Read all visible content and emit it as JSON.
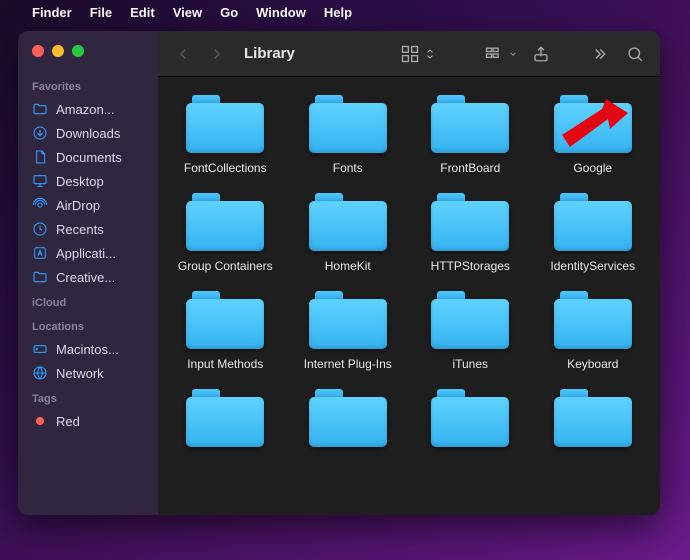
{
  "menubar": {
    "items": [
      "Finder",
      "File",
      "Edit",
      "View",
      "Go",
      "Window",
      "Help"
    ]
  },
  "window": {
    "title": "Library"
  },
  "sidebar": {
    "sections": {
      "favorites": {
        "label": "Favorites",
        "items": [
          {
            "icon": "folder",
            "label": "Amazon..."
          },
          {
            "icon": "download",
            "label": "Downloads"
          },
          {
            "icon": "document",
            "label": "Documents"
          },
          {
            "icon": "desktop",
            "label": "Desktop"
          },
          {
            "icon": "airdrop",
            "label": "AirDrop"
          },
          {
            "icon": "clock",
            "label": "Recents"
          },
          {
            "icon": "app",
            "label": "Applicati..."
          },
          {
            "icon": "folder",
            "label": "Creative..."
          }
        ]
      },
      "icloud": {
        "label": "iCloud"
      },
      "locations": {
        "label": "Locations",
        "items": [
          {
            "icon": "disk",
            "label": "Macintos..."
          },
          {
            "icon": "globe",
            "label": "Network"
          }
        ]
      },
      "tags": {
        "label": "Tags",
        "items": [
          {
            "icon": "dot-red",
            "label": "Red"
          }
        ]
      }
    }
  },
  "folders": [
    "FontCollections",
    "Fonts",
    "FrontBoard",
    "Google",
    "Group Containers",
    "HomeKit",
    "HTTPStorages",
    "IdentityServices",
    "Input Methods",
    "Internet Plug-Ins",
    "iTunes",
    "Keyboard",
    "",
    "",
    "",
    ""
  ],
  "annotation": {
    "target": "Google"
  }
}
